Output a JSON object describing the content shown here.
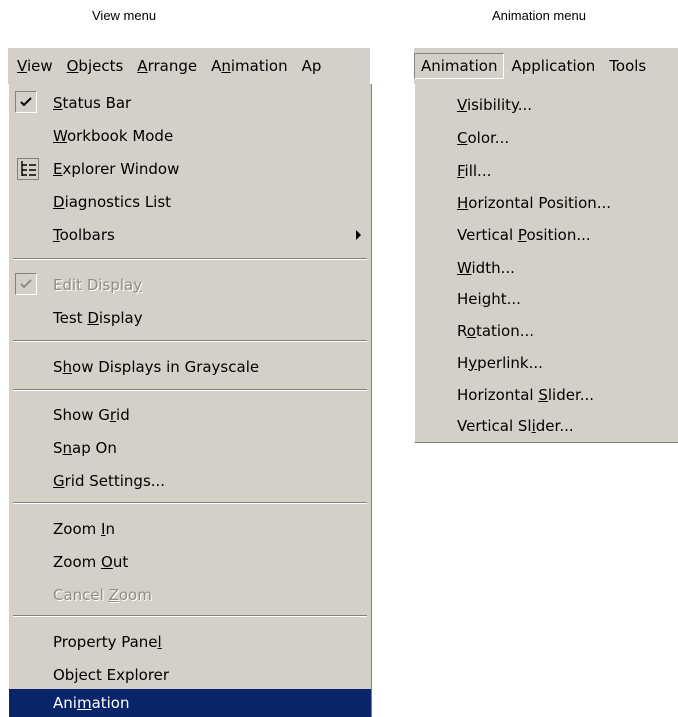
{
  "captions": {
    "view_menu": "View menu",
    "animation_menu": "Animation menu"
  },
  "menubar_left": {
    "items": [
      {
        "pre": "",
        "mn": "V",
        "post": "iew"
      },
      {
        "pre": "",
        "mn": "O",
        "post": "bjects"
      },
      {
        "pre": "",
        "mn": "A",
        "post": "rrange"
      },
      {
        "pre": "A",
        "mn": "n",
        "post": "imation"
      },
      {
        "pre": "Ap",
        "mn": "",
        "post": ""
      }
    ]
  },
  "menubar_right": {
    "items": [
      {
        "pre": "Animation",
        "mn": "",
        "post": ""
      },
      {
        "pre": "Application",
        "mn": "",
        "post": ""
      },
      {
        "pre": "Tools",
        "mn": "",
        "post": ""
      }
    ]
  },
  "view_menu": {
    "items": [
      {
        "pre": "",
        "mn": "S",
        "post": "tatus Bar",
        "checked": true
      },
      {
        "pre": "",
        "mn": "W",
        "post": "orkbook Mode"
      },
      {
        "pre": "",
        "mn": "E",
        "post": "xplorer Window",
        "icon": "explorer-window-icon"
      },
      {
        "pre": "",
        "mn": "D",
        "post": "iagnostics List"
      },
      {
        "pre": "",
        "mn": "T",
        "post": "oolbars",
        "submenu": true
      },
      {
        "pre": "Edit Displa",
        "mn": "y",
        "post": "",
        "checked": true,
        "disabled": true
      },
      {
        "pre": "Test ",
        "mn": "D",
        "post": "isplay"
      },
      {
        "pre": "S",
        "mn": "h",
        "post": "ow Displays in Grayscale"
      },
      {
        "pre": "Show G",
        "mn": "r",
        "post": "id"
      },
      {
        "pre": "S",
        "mn": "n",
        "post": "ap On"
      },
      {
        "pre": "",
        "mn": "G",
        "post": "rid Settings..."
      },
      {
        "pre": "Zoom ",
        "mn": "I",
        "post": "n"
      },
      {
        "pre": "Zoom ",
        "mn": "O",
        "post": "ut"
      },
      {
        "pre": "Cancel ",
        "mn": "Z",
        "post": "oom",
        "disabled": true
      },
      {
        "pre": "Property Pane",
        "mn": "l",
        "post": ""
      },
      {
        "pre": "Ob",
        "mn": "j",
        "post": "ect Explorer"
      },
      {
        "pre": "Ani",
        "mn": "m",
        "post": "ation",
        "selected": true
      }
    ]
  },
  "animation_menu": {
    "items": [
      {
        "pre": "",
        "mn": "V",
        "post": "isibility..."
      },
      {
        "pre": "",
        "mn": "C",
        "post": "olor..."
      },
      {
        "pre": "",
        "mn": "F",
        "post": "ill..."
      },
      {
        "pre": "",
        "mn": "H",
        "post": "orizontal Position..."
      },
      {
        "pre": "Vertical ",
        "mn": "P",
        "post": "osition..."
      },
      {
        "pre": "",
        "mn": "W",
        "post": "idth..."
      },
      {
        "pre": "Hei",
        "mn": "g",
        "post": "ht..."
      },
      {
        "pre": "R",
        "mn": "o",
        "post": "tation..."
      },
      {
        "pre": "H",
        "mn": "y",
        "post": "perlink..."
      },
      {
        "pre": "Horizontal ",
        "mn": "S",
        "post": "lider..."
      },
      {
        "pre": "Vertical Sl",
        "mn": "i",
        "post": "der..."
      }
    ]
  },
  "colors": {
    "menu_bg": "#d4d0c8",
    "highlight": "#0a246a",
    "disabled_text": "#8e8c86"
  }
}
